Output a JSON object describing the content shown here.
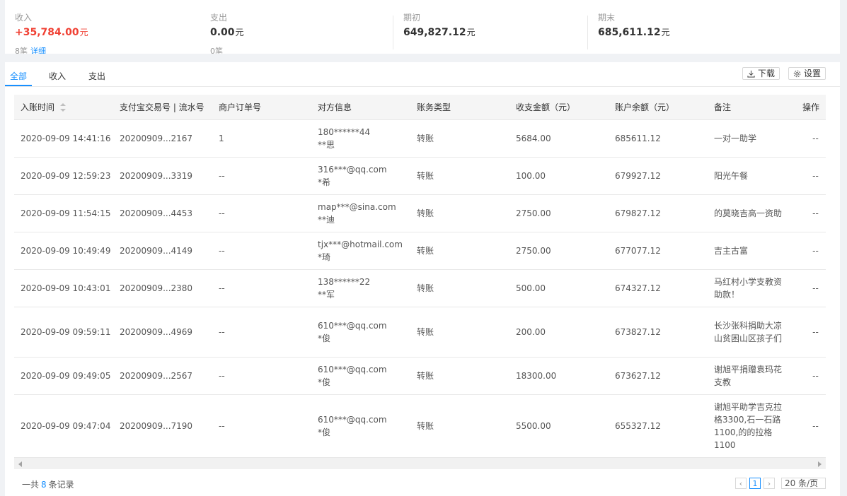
{
  "summary": {
    "income": {
      "label": "收入",
      "amount": "+35,784.00",
      "unit": "元",
      "count": "8笔",
      "detail_link": "详细"
    },
    "expense": {
      "label": "支出",
      "amount": "0.00",
      "unit": "元",
      "count": "0笔"
    },
    "opening": {
      "label": "期初",
      "amount": "649,827.12",
      "unit": "元"
    },
    "closing": {
      "label": "期末",
      "amount": "685,611.12",
      "unit": "元"
    }
  },
  "tabs": [
    {
      "label": "全部",
      "active": true
    },
    {
      "label": "收入",
      "active": false
    },
    {
      "label": "支出",
      "active": false
    }
  ],
  "toolbar": {
    "download_label": "下载",
    "settings_label": "设置"
  },
  "table": {
    "columns": [
      "入账时间",
      "支付宝交易号 | 流水号",
      "商户订单号",
      "对方信息",
      "账务类型",
      "收支金额（元）",
      "账户余额（元）",
      "备注",
      "操作"
    ],
    "rows": [
      {
        "time": "2020-09-09 14:41:16",
        "trade_no": "20200909...2167",
        "order_no": "1",
        "party_account": "180******44",
        "party_name": "**思",
        "type": "转账",
        "amount": "5684.00",
        "balance": "685611.12",
        "remark": "一对一助学",
        "ops": "--",
        "h": 53
      },
      {
        "time": "2020-09-09 12:59:23",
        "trade_no": "20200909...3319",
        "order_no": "--",
        "party_account": "316***@qq.com",
        "party_name": "*希",
        "type": "转账",
        "amount": "100.00",
        "balance": "679927.12",
        "remark": "阳光午餐",
        "ops": "--",
        "h": 53
      },
      {
        "time": "2020-09-09 11:54:15",
        "trade_no": "20200909...4453",
        "order_no": "--",
        "party_account": "map***@sina.com",
        "party_name": "**迪",
        "type": "转账",
        "amount": "2750.00",
        "balance": "679827.12",
        "remark": "的莫晓吉高一资助",
        "ops": "--",
        "h": 53
      },
      {
        "time": "2020-09-09 10:49:49",
        "trade_no": "20200909...4149",
        "order_no": "--",
        "party_account": "tjx***@hotmail.com",
        "party_name": "*琦",
        "type": "转账",
        "amount": "2750.00",
        "balance": "677077.12",
        "remark": "吉主古富",
        "ops": "--",
        "h": 53
      },
      {
        "time": "2020-09-09 10:43:01",
        "trade_no": "20200909...2380",
        "order_no": "--",
        "party_account": "138******22",
        "party_name": "**军",
        "type": "转账",
        "amount": "500.00",
        "balance": "674327.12",
        "remark": "马红村小学支教资助款！",
        "ops": "--",
        "h": 53
      },
      {
        "time": "2020-09-09 09:59:11",
        "trade_no": "20200909...4969",
        "order_no": "--",
        "party_account": "610***@qq.com",
        "party_name": "*俊",
        "type": "转账",
        "amount": "200.00",
        "balance": "673827.12",
        "remark": "长沙张科捐助大凉山贫困山区孩子们",
        "ops": "--",
        "h": 71
      },
      {
        "time": "2020-09-09 09:49:05",
        "trade_no": "20200909...2567",
        "order_no": "--",
        "party_account": "610***@qq.com",
        "party_name": "*俊",
        "type": "转账",
        "amount": "18300.00",
        "balance": "673627.12",
        "remark": "谢旭平捐赠袁玛花支教",
        "ops": "--",
        "h": 53
      },
      {
        "time": "2020-09-09 09:47:04",
        "trade_no": "20200909...7190",
        "order_no": "--",
        "party_account": "610***@qq.com",
        "party_name": "*俊",
        "type": "转账",
        "amount": "5500.00",
        "balance": "655327.12",
        "remark": "谢旭平助学吉克拉格3300,石一石路1100,的的拉格1100",
        "ops": "--",
        "h": 89
      }
    ]
  },
  "footer": {
    "total_prefix": "一共",
    "total_count": "8",
    "total_suffix": "条记录",
    "current_page": "1",
    "page_size": "20 条/页"
  },
  "colors": {
    "accent": "#1890ff",
    "income": "#f04134"
  }
}
